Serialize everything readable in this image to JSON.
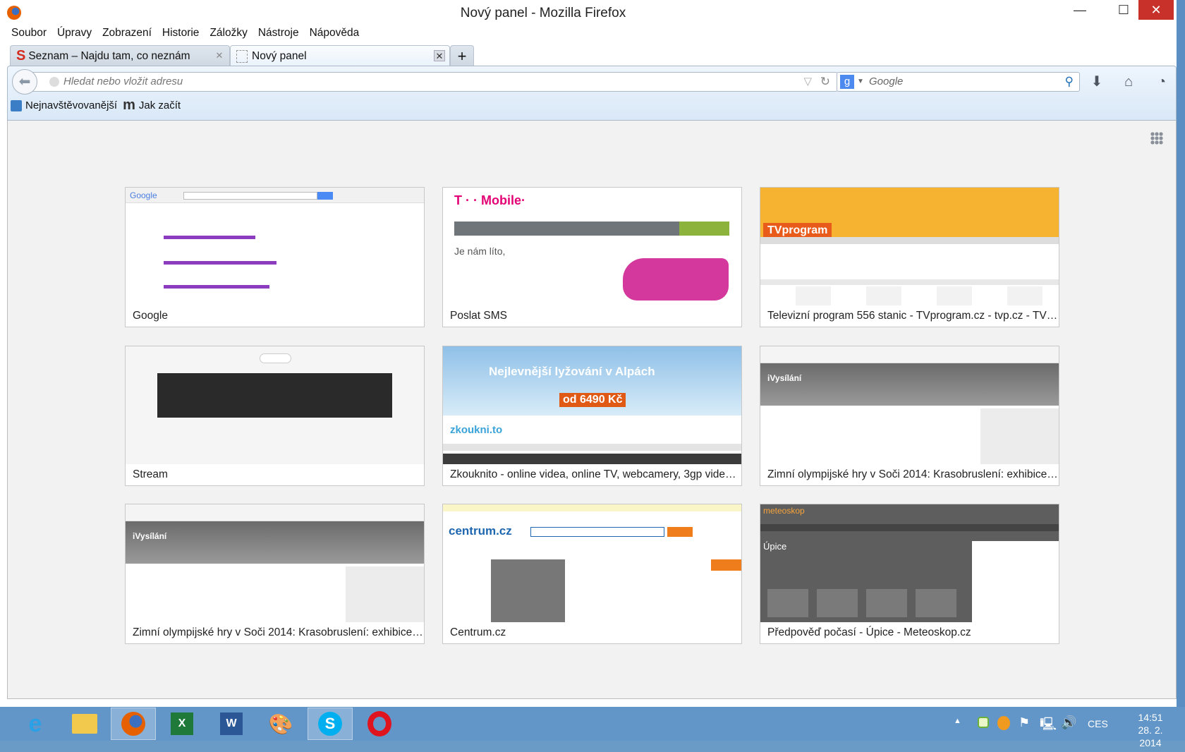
{
  "window": {
    "title": "Nový panel - Mozilla Firefox",
    "controls": {
      "minimize": "—",
      "maximize": "☐",
      "close": "✕"
    }
  },
  "menu": [
    "Soubor",
    "Úpravy",
    "Zobrazení",
    "Historie",
    "Záložky",
    "Nástroje",
    "Nápověda"
  ],
  "tabs": [
    {
      "label": "Seznam – Najdu tam, co neznám",
      "icon": "seznam-icon"
    },
    {
      "label": "Nový panel",
      "icon": "blank-page-icon"
    }
  ],
  "new_tab": "+",
  "urlbar": {
    "placeholder": "Hledat nebo vložit adresu"
  },
  "searchbar": {
    "engine": "g",
    "placeholder": "Google"
  },
  "bookmarks": [
    {
      "label": "Nejnavštěvovanější"
    },
    {
      "label": "Jak začít"
    }
  ],
  "tiles": [
    {
      "title": "Google"
    },
    {
      "title": "Poslat SMS"
    },
    {
      "title": "Televizní program 556 stanic - TVprogram.cz - tvp.cz - TV p..."
    },
    {
      "title": "Stream"
    },
    {
      "title": "Zkouknito - online videa, online TV, webcamery, 3gp videa,..."
    },
    {
      "title": "Zimní olympijské hry v Soči 2014: Krasobruslení: exhibice ..."
    },
    {
      "title": "Zimní olympijské hry v Soči 2014: Krasobruslení: exhibice ..."
    },
    {
      "title": "Centrum.cz"
    },
    {
      "title": "Předpověď počasí - Úpice - Meteoskop.cz"
    }
  ],
  "thumb_text": {
    "tmobile": "T · · Mobile·",
    "tvprogram": "TVprogram",
    "zkoukni_banner": "Nejlevnější lyžování v Alpách",
    "zkoukni_price": "od 6490 Kč",
    "zkoukni_logo": "zkoukni.to",
    "ivysilani": "iVysílání",
    "centrum": "centrum.cz",
    "meteoskop": "meteoskop",
    "upice": "Úpice",
    "google": "Google",
    "sorry": "Je nám líto,"
  },
  "tray": {
    "lang": "CES",
    "time": "14:51",
    "date": "28. 2. 2014"
  }
}
